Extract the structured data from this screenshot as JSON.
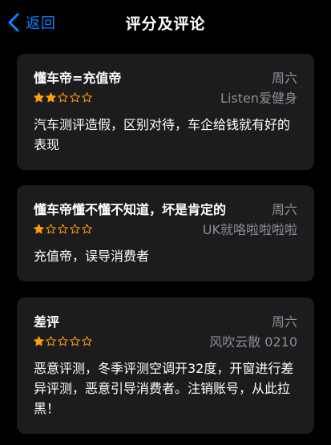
{
  "nav": {
    "back_label": "返回",
    "title": "评分及评论"
  },
  "colors": {
    "accent": "#0a84ff",
    "star": "#ff9f0a",
    "card_bg": "#1c1c1e",
    "secondary_text": "#8e8e93"
  },
  "reviews": [
    {
      "title": "懂车帝=充值帝",
      "date": "周六",
      "rating": 2,
      "max_rating": 5,
      "author": "Listen爱健身",
      "body": "汽车测评造假，区别对待，车企给钱就有好的表现"
    },
    {
      "title": "懂车帝懂不懂不知道，坏是肯定的",
      "date": "周六",
      "rating": 1,
      "max_rating": 5,
      "author": "UK就咯啦啦啦啦",
      "body": "充值帝，误导消费者"
    },
    {
      "title": "差评",
      "date": "周六",
      "rating": 1,
      "max_rating": 5,
      "author": "风吹云散 0210",
      "body": "恶意评测，冬季评测空调开32度，开窗进行差异评测，恶意引导消费者。注销账号，从此拉黑！"
    }
  ]
}
